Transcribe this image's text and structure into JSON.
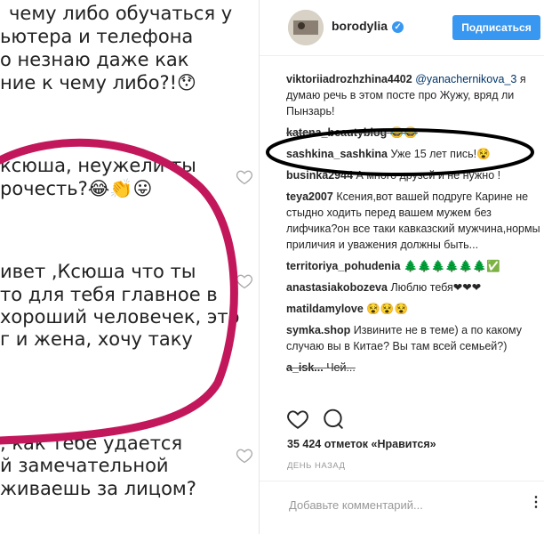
{
  "left_text": {
    "block1": [
      "чему либо обучаться у",
      "ьютера и телефона",
      "о незнаю даже как",
      "ние к чему либо?!😯"
    ],
    "block2": [
      "ксюша, неужели ты",
      "рочесть?😂👏😛"
    ],
    "block3": [
      "ивет ,Ксюша что ты",
      "то для тебя главное в",
      "хороший человечек, это",
      "г и жена, хочу таку"
    ],
    "block4": [
      ", как тебе удается",
      "й замечательной",
      "живаешь за лицом?"
    ]
  },
  "post": {
    "username": "borodylia",
    "follow_label": "Подписаться",
    "comments": [
      {
        "user": "viktoriiadrozhzhina4402",
        "mention": "@yanachernikova_3",
        "text": " я думаю речь в этом посте про Жужу, вряд ли Пынзарь!"
      },
      {
        "user": "katena_beautyblog",
        "mention": "",
        "text": "😂😂"
      },
      {
        "user": "sashkina_sashkina",
        "mention": "",
        "text": "Уже 15 лет пись!😵"
      },
      {
        "user": "businka2944",
        "mention": "",
        "text": "А много друзей и не нужно !"
      },
      {
        "user": "teya2007",
        "mention": "",
        "text": "Ксения,вот вашей подруге Карине не стыдно ходить перед вашем мужем без лифчика?он все таки кавказский мужчина,нормы приличия и уважения должны быть..."
      },
      {
        "user": "territoriya_pohudenia",
        "mention": "",
        "text": "🌲🌲🌲🌲🌲🌲✅"
      },
      {
        "user": "anastasiakobozeva",
        "mention": "",
        "text": "Люблю тебя❤❤❤"
      },
      {
        "user": "matildamylove",
        "mention": "",
        "text": "😵😵😵"
      },
      {
        "user": "symka.shop",
        "mention": "",
        "text": "Извините не в теме) а по какому случаю вы в Китае? Вы там всей семьей?)"
      },
      {
        "user": "a_isk...",
        "mention": "",
        "text": "Чей..."
      }
    ],
    "likes": "35 424 отметок «Нравится»",
    "time": "ДЕНЬ НАЗАД",
    "add_comment_placeholder": "Добавьте комментарий..."
  },
  "colors": {
    "follow": "#3897f0",
    "marker_circle": "#c2185b",
    "ink": "#000000"
  }
}
